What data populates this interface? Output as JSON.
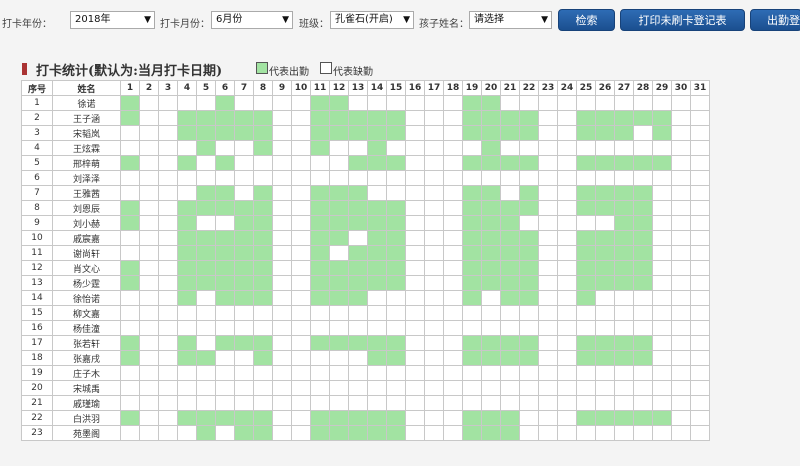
{
  "toolbar": {
    "year_label": "打卡年份：",
    "year_value": "2018年",
    "month_label": "打卡月份：",
    "month_value": "6月份",
    "class_label": "班级：",
    "class_value": "孔雀石(开启)",
    "child_label": "孩子姓名：",
    "child_value": "请选择",
    "search_button": "检索",
    "print_button": "打印未刷卡登记表",
    "attendance_button": "出勤登"
  },
  "section": {
    "title": "打卡统计(默认为:当月打卡日期)",
    "legend_present": "代表出勤",
    "legend_absent": "代表缺勤"
  },
  "colors": {
    "present": "#a2e3a2",
    "absent": "#ffffff",
    "button": "#2e6cb5"
  },
  "table": {
    "headers": [
      "序号",
      "姓名"
    ],
    "days": [
      "1",
      "2",
      "3",
      "4",
      "5",
      "6",
      "7",
      "8",
      "9",
      "10",
      "11",
      "12",
      "13",
      "14",
      "15",
      "16",
      "17",
      "18",
      "19",
      "20",
      "21",
      "22",
      "23",
      "24",
      "25",
      "26",
      "27",
      "28",
      "29",
      "30",
      "31"
    ],
    "rows": [
      {
        "no": "1",
        "name": "徐诺",
        "present": [
          1,
          6,
          11,
          12,
          19,
          20
        ]
      },
      {
        "no": "2",
        "name": "王子涵",
        "present": [
          1,
          4,
          5,
          6,
          7,
          8,
          11,
          12,
          13,
          14,
          15,
          19,
          20,
          21,
          22,
          25,
          26,
          27,
          28,
          29
        ]
      },
      {
        "no": "3",
        "name": "宋韬岚",
        "present": [
          4,
          5,
          6,
          7,
          8,
          11,
          12,
          13,
          14,
          15,
          19,
          20,
          21,
          22,
          25,
          26,
          27,
          29
        ]
      },
      {
        "no": "4",
        "name": "王炫霖",
        "present": [
          5,
          8,
          11,
          14,
          20
        ]
      },
      {
        "no": "5",
        "name": "邢梓萌",
        "present": [
          1,
          4,
          6,
          13,
          14,
          15,
          19,
          20,
          21,
          22,
          25,
          26,
          27,
          28,
          29
        ]
      },
      {
        "no": "6",
        "name": "刘泽泽",
        "present": []
      },
      {
        "no": "7",
        "name": "王雅茜",
        "present": [
          5,
          6,
          8,
          11,
          12,
          13,
          19,
          20,
          22,
          25,
          26,
          27,
          28
        ]
      },
      {
        "no": "8",
        "name": "刘恩辰",
        "present": [
          1,
          4,
          5,
          6,
          7,
          8,
          11,
          12,
          13,
          14,
          15,
          19,
          20,
          21,
          22,
          25,
          26,
          27,
          28
        ]
      },
      {
        "no": "9",
        "name": "刘小赫",
        "present": [
          1,
          4,
          7,
          8,
          11,
          12,
          13,
          14,
          15,
          19,
          20,
          21,
          27,
          28
        ]
      },
      {
        "no": "10",
        "name": "戚宸嘉",
        "present": [
          4,
          5,
          6,
          7,
          8,
          11,
          12,
          14,
          15,
          19,
          20,
          21,
          22,
          25,
          26,
          27,
          28
        ]
      },
      {
        "no": "11",
        "name": "谢尚轩",
        "present": [
          4,
          5,
          6,
          7,
          8,
          11,
          13,
          14,
          15,
          19,
          20,
          21,
          22,
          25,
          26,
          27,
          28
        ]
      },
      {
        "no": "12",
        "name": "肖文心",
        "present": [
          1,
          4,
          5,
          6,
          7,
          8,
          11,
          12,
          13,
          14,
          15,
          19,
          20,
          21,
          22,
          25,
          26,
          27,
          28
        ]
      },
      {
        "no": "13",
        "name": "杨少霆",
        "present": [
          1,
          4,
          5,
          6,
          7,
          8,
          11,
          12,
          13,
          14,
          15,
          19,
          20,
          21,
          22,
          25,
          26,
          27,
          28
        ]
      },
      {
        "no": "14",
        "name": "徐怡诺",
        "present": [
          4,
          6,
          7,
          8,
          11,
          12,
          13,
          19,
          21,
          22,
          25
        ]
      },
      {
        "no": "15",
        "name": "柳文嘉",
        "present": []
      },
      {
        "no": "16",
        "name": "杨佳潼",
        "present": []
      },
      {
        "no": "17",
        "name": "张若轩",
        "present": [
          1,
          4,
          6,
          7,
          8,
          11,
          12,
          13,
          14,
          15,
          19,
          20,
          21,
          22,
          25,
          26,
          27,
          28
        ]
      },
      {
        "no": "18",
        "name": "张嘉戌",
        "present": [
          1,
          4,
          5,
          8,
          14,
          15,
          19,
          20,
          21,
          22,
          25,
          26,
          27,
          28
        ]
      },
      {
        "no": "19",
        "name": "庄子木",
        "present": []
      },
      {
        "no": "20",
        "name": "宋城禹",
        "present": []
      },
      {
        "no": "21",
        "name": "戚瑾瑜",
        "present": []
      },
      {
        "no": "22",
        "name": "白洪羽",
        "present": [
          1,
          4,
          5,
          6,
          7,
          8,
          11,
          12,
          13,
          14,
          15,
          19,
          20,
          21,
          25,
          26,
          27,
          28,
          29
        ]
      },
      {
        "no": "23",
        "name": "苑墨阁",
        "present": [
          5,
          7,
          8,
          11,
          12,
          13,
          14,
          15,
          19,
          20,
          21
        ]
      }
    ]
  }
}
